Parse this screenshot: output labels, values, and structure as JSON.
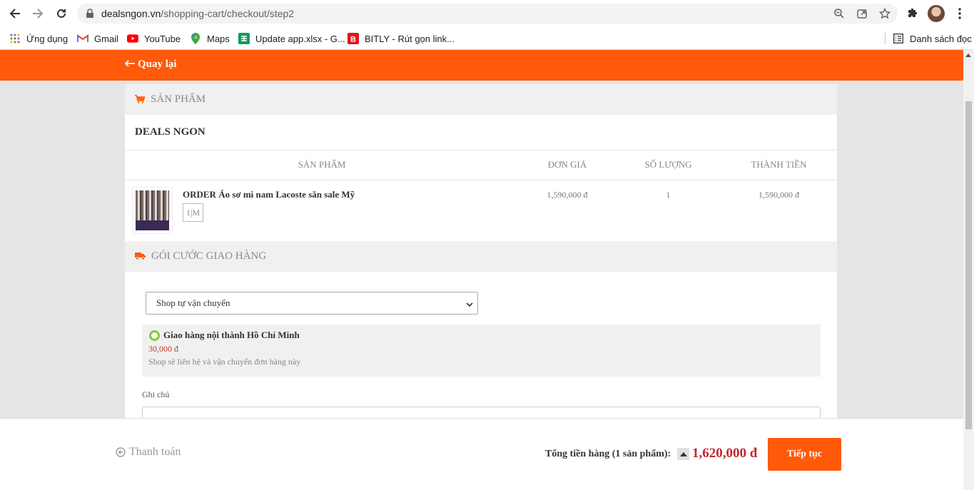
{
  "browser": {
    "url_host": "dealsngon.vn",
    "url_path": "/shopping-cart/checkout/step2",
    "bookmarks": [
      {
        "label": "Ứng dụng",
        "icon": "apps-grid-icon"
      },
      {
        "label": "Gmail",
        "icon": "gmail-icon"
      },
      {
        "label": "YouTube",
        "icon": "youtube-icon"
      },
      {
        "label": "Maps",
        "icon": "maps-icon"
      },
      {
        "label": "Update app.xlsx - G...",
        "icon": "sheets-icon"
      },
      {
        "label": "BITLY - Rút gọn link...",
        "icon": "bitly-icon"
      }
    ],
    "reading_list": "Danh sách đọc"
  },
  "header": {
    "back_label": "Quay lại"
  },
  "products_section": {
    "title": "SẢN PHẨM",
    "shop_name": "DEALS NGON",
    "columns": [
      "SẢN PHẨM",
      "ĐƠN GIÁ",
      "SỐ LƯỢNG",
      "THÀNH TIỀN"
    ],
    "items": [
      {
        "name": "ORDER Áo sơ mi nam Lacoste săn sale Mỹ",
        "variant": "1|M",
        "unit_price": "1,590,000 đ",
        "quantity": "1",
        "subtotal": "1,590,000 đ"
      }
    ]
  },
  "shipping_section": {
    "title": "GÓI CƯỚC GIAO HÀNG",
    "select_value": "Shop tự vận chuyển",
    "option": {
      "name": "Giao hàng nội thành Hồ Chí Minh",
      "price": "30,000 đ",
      "description": "Shop sẽ liên hệ và vận chuyển đơn hàng này"
    },
    "note_label": "Ghi chú"
  },
  "footer": {
    "payment_label": "Thanh toán",
    "total_label": "Tổng tiền hàng (1 sản phẩm):",
    "total_value": "1,620,000 đ",
    "continue_label": "Tiếp tục"
  },
  "colors": {
    "brand": "#ff5a09",
    "price": "#c0272d"
  }
}
